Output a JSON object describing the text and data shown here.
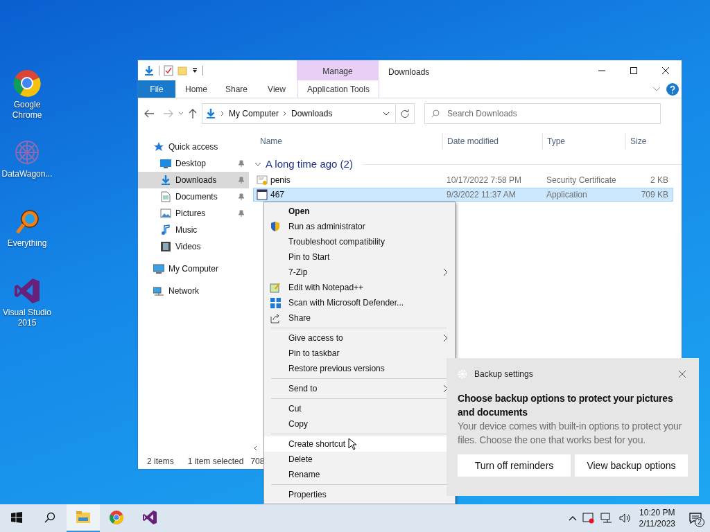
{
  "desktop_icons": [
    {
      "label": "Google Chrome"
    },
    {
      "label": "DataWagon..."
    },
    {
      "label": "Everything"
    },
    {
      "label": "Visual Studio 2015"
    }
  ],
  "explorer": {
    "title": "Downloads",
    "context_header": "Manage",
    "ribbon_tabs": [
      {
        "label": "File",
        "kind": "file"
      },
      {
        "label": "Home",
        "kind": "plain"
      },
      {
        "label": "Share",
        "kind": "plain"
      },
      {
        "label": "View",
        "kind": "plain"
      },
      {
        "label": "Application Tools",
        "kind": "context"
      }
    ],
    "breadcrumbs": [
      "My Computer",
      "Downloads"
    ],
    "search": {
      "placeholder": "Search Downloads"
    },
    "nav": [
      {
        "label": "Quick access",
        "selected": false,
        "children": [
          {
            "label": "Desktop",
            "pinned": true,
            "selected": false
          },
          {
            "label": "Downloads",
            "pinned": true,
            "selected": true
          },
          {
            "label": "Documents",
            "pinned": true,
            "selected": false
          },
          {
            "label": "Pictures",
            "pinned": true,
            "selected": false
          },
          {
            "label": "Music",
            "pinned": false,
            "selected": false
          },
          {
            "label": "Videos",
            "pinned": false,
            "selected": false
          }
        ]
      },
      {
        "label": "My Computer",
        "selected": false
      },
      {
        "label": "Network",
        "selected": false
      }
    ],
    "columns": [
      "Name",
      "Date modified",
      "Type",
      "Size"
    ],
    "group": "A long time ago (2)",
    "rows": [
      {
        "name": "penis",
        "date": "10/17/2022 7:58 PM",
        "type": "Security Certificate",
        "size": "2 KB",
        "selected": false
      },
      {
        "name": "467",
        "date": "9/3/2022 11:37 AM",
        "type": "Application",
        "size": "709 KB",
        "selected": true
      }
    ],
    "status_bar": [
      "2 items",
      "1 item selected",
      "708"
    ]
  },
  "context_menu": [
    {
      "kind": "item",
      "label": "Open",
      "bold": true,
      "submenu": false,
      "selected": false
    },
    {
      "kind": "item",
      "label": "Run as administrator",
      "bold": false,
      "submenu": false,
      "selected": false
    },
    {
      "kind": "item",
      "label": "Troubleshoot compatibility",
      "bold": false,
      "submenu": false,
      "selected": false
    },
    {
      "kind": "item",
      "label": "Pin to Start",
      "bold": false,
      "submenu": false,
      "selected": false
    },
    {
      "kind": "item",
      "label": "7-Zip",
      "bold": false,
      "submenu": true,
      "selected": false
    },
    {
      "kind": "item",
      "label": "Edit with Notepad++",
      "bold": false,
      "submenu": false,
      "selected": false
    },
    {
      "kind": "item",
      "label": "Scan with Microsoft Defender...",
      "bold": false,
      "submenu": false,
      "selected": false
    },
    {
      "kind": "item",
      "label": "Share",
      "bold": false,
      "submenu": false,
      "selected": false
    },
    {
      "kind": "separator"
    },
    {
      "kind": "item",
      "label": "Give access to",
      "bold": false,
      "submenu": true,
      "selected": false
    },
    {
      "kind": "item",
      "label": "Pin to taskbar",
      "bold": false,
      "submenu": false,
      "selected": false
    },
    {
      "kind": "item",
      "label": "Restore previous versions",
      "bold": false,
      "submenu": false,
      "selected": false
    },
    {
      "kind": "separator"
    },
    {
      "kind": "item",
      "label": "Send to",
      "bold": false,
      "submenu": true,
      "selected": false
    },
    {
      "kind": "separator"
    },
    {
      "kind": "item",
      "label": "Cut",
      "bold": false,
      "submenu": false,
      "selected": false
    },
    {
      "kind": "item",
      "label": "Copy",
      "bold": false,
      "submenu": false,
      "selected": false
    },
    {
      "kind": "separator"
    },
    {
      "kind": "item",
      "label": "Create shortcut",
      "bold": false,
      "submenu": false,
      "selected": true
    },
    {
      "kind": "item",
      "label": "Delete",
      "bold": false,
      "submenu": false,
      "selected": false
    },
    {
      "kind": "item",
      "label": "Rename",
      "bold": false,
      "submenu": false,
      "selected": false
    },
    {
      "kind": "separator"
    },
    {
      "kind": "item",
      "label": "Properties",
      "bold": false,
      "submenu": false,
      "selected": false
    }
  ],
  "notification": {
    "app": "Backup settings",
    "heading": "Choose backup options to protect your pictures and documents",
    "body": "Your device comes with built-in options to protect your files. Choose the one that works best for you.",
    "buttons": [
      "Turn off reminders",
      "View backup options"
    ]
  },
  "taskbar": {
    "apps": [
      {
        "selected": false
      },
      {
        "selected": false
      },
      {
        "selected": true
      },
      {
        "selected": false
      },
      {
        "selected": false
      }
    ],
    "time": "10:20 PM",
    "date": "2/11/2023",
    "notification_count": "2"
  }
}
